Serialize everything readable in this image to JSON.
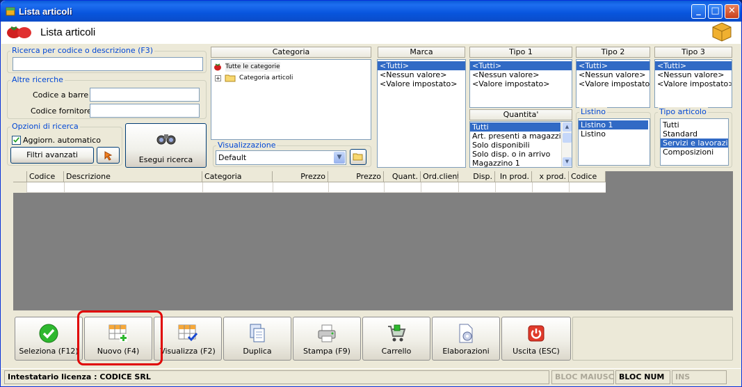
{
  "window": {
    "title": "Lista articoli",
    "controls": [
      "_",
      "□",
      "✕"
    ]
  },
  "header": {
    "title": "Lista articoli"
  },
  "search": {
    "group_label": "Ricerca per codice o descrizione (F3)",
    "value": ""
  },
  "other_searches": {
    "group_label": "Altre ricerche",
    "barcode_label": "Codice a barre :",
    "barcode_value": "",
    "supplier_code_label": "Codice fornitore :",
    "supplier_code_value": ""
  },
  "search_options": {
    "group_label": "Opzioni di ricerca",
    "auto_update_label": "Aggiorn. automatico",
    "auto_update_checked": true,
    "advanced_filters_label": "Filtri avanzati",
    "run_search_label": "Esegui ricerca"
  },
  "category": {
    "header": "Categoria",
    "items": [
      "Tutte le categorie",
      "Categoria articoli"
    ]
  },
  "view": {
    "group_label": "Visualizzazione",
    "selected": "Default"
  },
  "marca": {
    "header": "Marca",
    "items": [
      "<Tutti>",
      "<Nessun valore>",
      "<Valore impostato>"
    ],
    "selected": 0
  },
  "tipo1": {
    "header": "Tipo 1",
    "items": [
      "<Tutti>",
      "<Nessun valore>",
      "<Valore impostato>"
    ],
    "selected": 0
  },
  "tipo2": {
    "header": "Tipo 2",
    "items": [
      "<Tutti>",
      "<Nessun valore>",
      "<Valore impostato>"
    ],
    "selected": 0
  },
  "tipo3": {
    "header": "Tipo 3",
    "items": [
      "<Tutti>",
      "<Nessun valore>",
      "<Valore impostato>"
    ],
    "selected": 0
  },
  "quantita": {
    "header": "Quantita'",
    "items": [
      "Tutti",
      "Art. presenti a magazzino",
      "Solo disponibili",
      "Solo disp. o in arrivo",
      "Magazzino 1"
    ],
    "selected": 0
  },
  "listino": {
    "group_label": "Listino",
    "items": [
      "Listino 1",
      "Listino"
    ],
    "selected": 0
  },
  "tipo_articolo": {
    "group_label": "Tipo articolo",
    "items": [
      "Tutti",
      "Standard",
      "Servizi e lavorazioni",
      "Composizioni"
    ],
    "selected": 2
  },
  "grid": {
    "columns": [
      "Codice",
      "Descrizione",
      "Categoria",
      "Prezzo",
      "Prezzo",
      "Quant.",
      "Ord.clienti",
      "Disp.",
      "In prod.",
      "x prod.",
      "Codice"
    ]
  },
  "toolbar": {
    "buttons": [
      "Seleziona (F12)",
      "Nuovo (F4)",
      "Visualizza (F2)",
      "Duplica",
      "Stampa (F9)",
      "Carrello",
      "Elaborazioni",
      "Uscita (ESC)"
    ]
  },
  "status": {
    "license": "Intestatario licenza : CODICE SRL",
    "caps": "BLOC MAIUSC",
    "num": "BLOC NUM",
    "ins": "INS"
  },
  "colors": {
    "highlight": "#e00000",
    "selection": "#316ac5",
    "title_blue": "#0046d5"
  }
}
